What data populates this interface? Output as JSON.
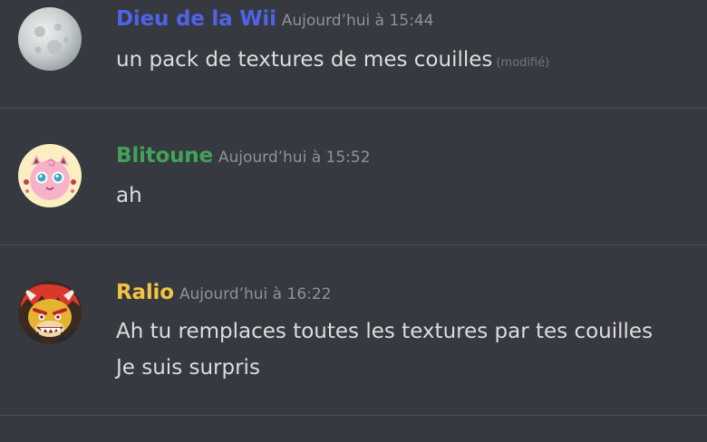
{
  "messages": [
    {
      "author": "Dieu de la Wii",
      "author_color": "#4f63e8",
      "timestamp": "Aujourd’hui à 15:44",
      "lines": [
        "un pack de textures de mes couilles"
      ],
      "edited": "(modifié)",
      "avatar_icon": "moon-avatar-icon"
    },
    {
      "author": "Blitoune",
      "author_color": "#43a25a",
      "timestamp": "Aujourd’hui à 15:52",
      "lines": [
        "ah"
      ],
      "avatar_icon": "jigglypuff-avatar-icon"
    },
    {
      "author": "Ralio",
      "author_color": "#f5c342",
      "timestamp": "Aujourd’hui à 16:22",
      "lines": [
        "Ah tu remplaces toutes les textures par tes couilles",
        "Je suis surpris"
      ],
      "avatar_icon": "bowser-avatar-icon"
    }
  ],
  "colors": {
    "background": "#36393f",
    "text": "#dcddde",
    "timestamp": "#8e9297",
    "divider": "#4a4d53"
  }
}
